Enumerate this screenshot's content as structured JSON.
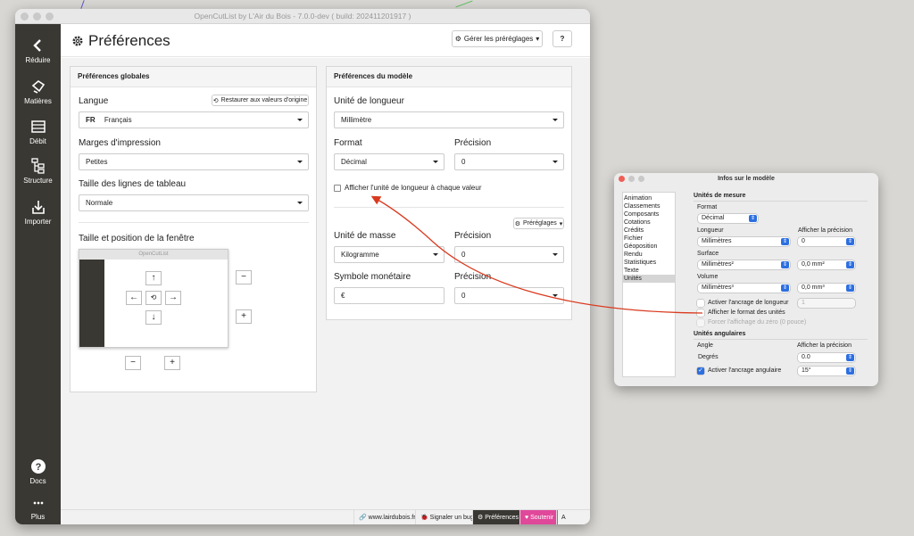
{
  "window_title": "OpenCutList by L'Air du Bois - 7.0.0-dev ( build: 202411201917 )",
  "sidebar": {
    "items": [
      {
        "label": "Réduire",
        "icon": "chevron-left-icon"
      },
      {
        "label": "Matières",
        "icon": "material-icon"
      },
      {
        "label": "Débit",
        "icon": "cutlist-icon"
      },
      {
        "label": "Structure",
        "icon": "structure-icon"
      },
      {
        "label": "Importer",
        "icon": "import-icon"
      },
      {
        "label": "Docs",
        "icon": "help-icon"
      },
      {
        "label": "Plus",
        "icon": "more-icon"
      }
    ]
  },
  "header": {
    "title": "Préférences",
    "presets_label": "Gérer les préréglages",
    "help_label": "?"
  },
  "global": {
    "title": "Préférences globales",
    "lang_label": "Langue",
    "restore_label": "Restaurer aux valeurs d'origine",
    "lang_code": "FR",
    "lang_value": "Français",
    "margins_label": "Marges d'impression",
    "margins_value": "Petites",
    "rows_label": "Taille des lignes de tableau",
    "rows_value": "Normale",
    "window_label": "Taille et position de la fenêtre",
    "mini_title": "OpenCutList",
    "minus": "−",
    "plus": "+"
  },
  "model": {
    "title": "Préférences du modèle",
    "length_unit_label": "Unité de longueur",
    "length_unit_value": "Millimètre",
    "format_label": "Format",
    "format_value": "Décimal",
    "precision_label": "Précision",
    "precision_value": "0",
    "show_unit_label": "Afficher l'unité de longueur à chaque valeur",
    "presets_small": "Préréglages",
    "mass_label": "Unité de masse",
    "mass_value": "Kilogramme",
    "mass_precision_label": "Précision",
    "mass_precision_value": "0",
    "currency_label": "Symbole monétaire",
    "currency_value": "€",
    "currency_precision_label": "Précision",
    "currency_precision_value": "0"
  },
  "footer": {
    "site": "www.lairdubois.fr",
    "bug": "Signaler un bug",
    "prefs": "Préférences",
    "support": "Soutenir",
    "about": "A propos"
  },
  "info_window": {
    "title": "Infos sur le modèle",
    "list": [
      "Animation",
      "Classements",
      "Composants",
      "Cotations",
      "Crédits",
      "Fichier",
      "Géoposition",
      "Rendu",
      "Statistiques",
      "Texte",
      "Unités"
    ],
    "units_heading": "Unités de mesure",
    "format_label": "Format",
    "format_value": "Décimal",
    "show_precision": "Afficher la précision",
    "length_label": "Longueur",
    "length_value": "Millimètres",
    "length_precision": "0",
    "surface_label": "Surface",
    "surface_value": "Millimètres²",
    "surface_precision": "0,0 mm²",
    "volume_label": "Volume",
    "volume_value": "Millimètres³",
    "volume_precision": "0,0 mm³",
    "snap_length": "Activer l'ancrage de longueur",
    "snap_length_value": "1",
    "show_format": "Afficher le format des unités",
    "force_zero": "Forcer l'affichage du zéro (0 pouce)",
    "angular_heading": "Unités angulaires",
    "angle_label": "Angle",
    "angle_show_precision": "Afficher la précision",
    "degrees_label": "Degrés",
    "degrees_value": "0.0",
    "snap_angle": "Activer l'ancrage angulaire",
    "snap_angle_value": "15°"
  },
  "colors": {
    "sidebar": "#3a3833",
    "support_pink": "#e0489a",
    "annotation_red": "#d93a1f",
    "mac_blue": "#2d6fe0"
  }
}
